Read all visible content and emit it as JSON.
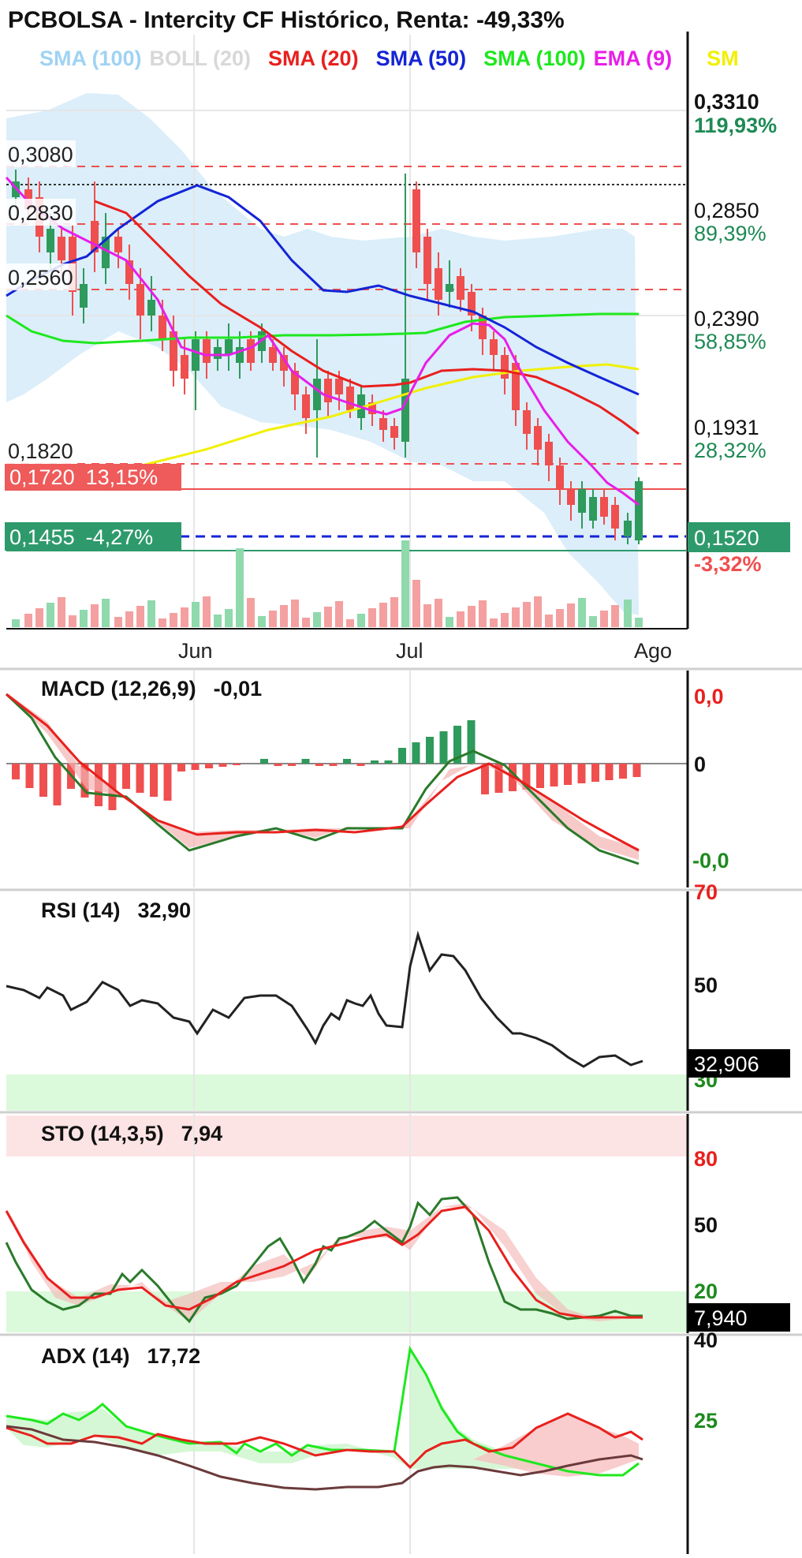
{
  "title": "PCBOLSA - Intercity CF Histórico, Renta: -49,33%",
  "legend": [
    {
      "label": "SMA (100)",
      "color": "#9fd3f3"
    },
    {
      "label": "BOLL (20)",
      "color": "#d8d8d8"
    },
    {
      "label": "SMA (20)",
      "color": "#e8201d"
    },
    {
      "label": "SMA (50)",
      "color": "#1424d6"
    },
    {
      "label": "SMA (100)",
      "color": "#1ee81e"
    },
    {
      "label": "EMA (9)",
      "color": "#e81ee8"
    },
    {
      "label": "SM",
      "color": "#f0f000"
    }
  ],
  "price_axis": [
    {
      "value": "0,3310",
      "pct": "119,93%",
      "pct_color": "#1e8a55"
    },
    {
      "value": "0,2850",
      "pct": "89,39%",
      "pct_color": "#1e8a55"
    },
    {
      "value": "0,2390",
      "pct": "58,85%",
      "pct_color": "#1e8a55"
    },
    {
      "value": "0,1931",
      "pct": "28,32%",
      "pct_color": "#1e8a55"
    }
  ],
  "current_price": {
    "value": "0,1520",
    "pct": "-3,32%"
  },
  "level_labels": [
    "0,3080",
    "0,2830",
    "0,2560",
    "0,1820"
  ],
  "red_box": {
    "value": "0,1720",
    "pct": "13,15%"
  },
  "green_box": {
    "value": "0,1455",
    "pct": "-4,27%"
  },
  "x_axis": [
    "Jun",
    "Jul",
    "Ago"
  ],
  "macd": {
    "label": "MACD (12,26,9)",
    "value": "-0,01",
    "axis": [
      "0,0",
      "0",
      "-0,0"
    ]
  },
  "rsi": {
    "label": "RSI (14)",
    "value": "32,90",
    "axis_top": "70",
    "axis_mid": "50",
    "axis_low": "30",
    "current": "32,906"
  },
  "sto": {
    "label": "STO (14,3,5)",
    "value": "7,94",
    "axis": [
      "80",
      "50",
      "20"
    ],
    "current": "7,940"
  },
  "adx": {
    "label": "ADX (14)",
    "value": "17,72",
    "axis": [
      "40",
      "25"
    ]
  },
  "colors": {
    "up": "#2e9a5b",
    "down": "#ef4f4f",
    "teal": "#2e9a6b"
  },
  "chart_data": {
    "type": "line",
    "title": "PCBOLSA - Intercity CF Histórico, Renta: -49,33%",
    "x": [
      "Jun",
      "Jul",
      "Ago"
    ],
    "series": [
      {
        "name": "SMA (20)"
      },
      {
        "name": "SMA (50)"
      },
      {
        "name": "SMA (100)"
      },
      {
        "name": "EMA (9)"
      }
    ],
    "ylim": [
      0.13,
      0.331
    ],
    "levels": [
      0.308,
      0.283,
      0.256,
      0.182,
      0.172,
      0.1455
    ],
    "last": 0.152
  }
}
